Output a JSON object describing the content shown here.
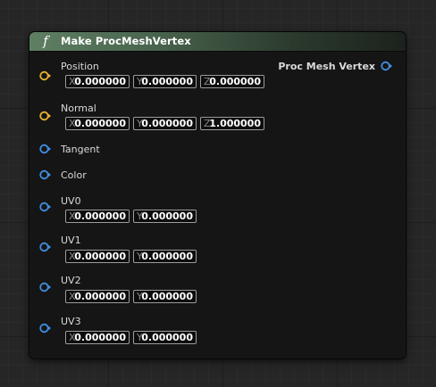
{
  "node": {
    "title": "Make ProcMeshVertex",
    "icon": "function-icon"
  },
  "output": {
    "label": "Proc Mesh Vertex",
    "pin_color": "#3f8fe0"
  },
  "colors": {
    "vector_pin": "#e8b030",
    "struct_pin": "#3f8fe0",
    "header_accent": "#5f7f63"
  },
  "inputs": {
    "position": {
      "label": "Position",
      "x_axis": "X",
      "x": "0.000000",
      "y_axis": "Y",
      "y": "0.000000",
      "z_axis": "Z",
      "z": "0.000000"
    },
    "normal": {
      "label": "Normal",
      "x_axis": "X",
      "x": "0.000000",
      "y_axis": "Y",
      "y": "0.000000",
      "z_axis": "Z",
      "z": "1.000000"
    },
    "tangent": {
      "label": "Tangent"
    },
    "color": {
      "label": "Color"
    },
    "uv0": {
      "label": "UV0",
      "x_axis": "X",
      "x": "0.000000",
      "y_axis": "Y",
      "y": "0.000000"
    },
    "uv1": {
      "label": "UV1",
      "x_axis": "X",
      "x": "0.000000",
      "y_axis": "Y",
      "y": "0.000000"
    },
    "uv2": {
      "label": "UV2",
      "x_axis": "X",
      "x": "0.000000",
      "y_axis": "Y",
      "y": "0.000000"
    },
    "uv3": {
      "label": "UV3",
      "x_axis": "X",
      "x": "0.000000",
      "y_axis": "Y",
      "y": "0.000000"
    }
  }
}
